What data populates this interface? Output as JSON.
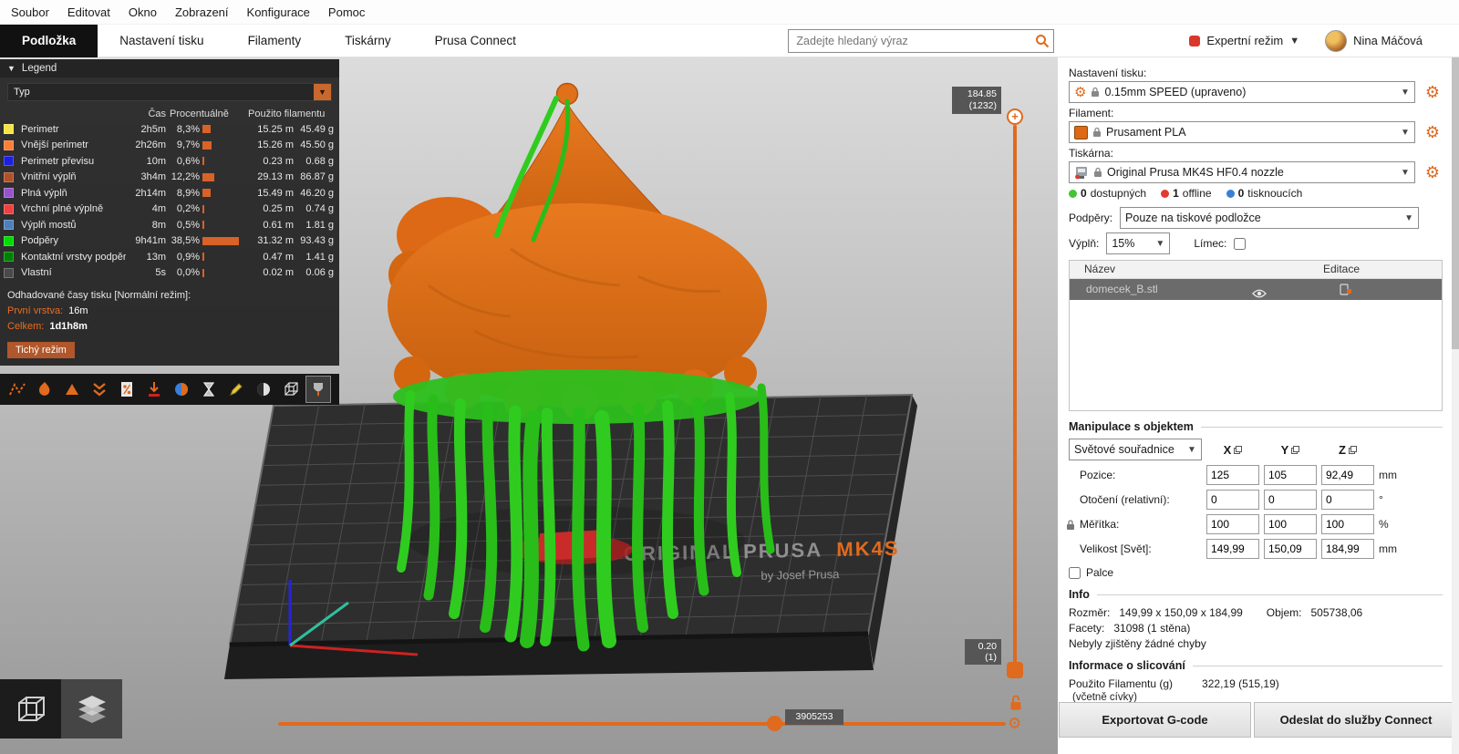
{
  "menubar": {
    "items": [
      "Soubor",
      "Editovat",
      "Okno",
      "Zobrazení",
      "Konfigurace",
      "Pomoc"
    ]
  },
  "tabbar": {
    "tabs": [
      "Podložka",
      "Nastavení tisku",
      "Filamenty",
      "Tiskárny",
      "Prusa Connect"
    ],
    "active_tab": "Podložka",
    "search_placeholder": "Zadejte hledaný výraz",
    "mode_label": "Expertní režim",
    "user_name": "Nina Máčová"
  },
  "legend": {
    "title": "Legend",
    "type_value": "Typ",
    "columns": {
      "time": "Čas",
      "percent": "Procentuálně",
      "used": "Použito filamentu"
    },
    "rows": [
      {
        "label": "Perimetr",
        "color": "#F5E445",
        "time": "2h5m",
        "pct": "8,3%",
        "pct_num": 8.3,
        "len": "15.25 m",
        "weight": "45.49 g"
      },
      {
        "label": "Vnější perimetr",
        "color": "#FF7D38",
        "time": "2h26m",
        "pct": "9,7%",
        "pct_num": 9.7,
        "len": "15.26 m",
        "weight": "45.50 g"
      },
      {
        "label": "Perimetr převisu",
        "color": "#1F1FDE",
        "time": "10m",
        "pct": "0,6%",
        "pct_num": 0.6,
        "len": "0.23 m",
        "weight": "0.68 g"
      },
      {
        "label": "Vnitřní výplň",
        "color": "#B05129",
        "time": "3h4m",
        "pct": "12,2%",
        "pct_num": 12.2,
        "len": "29.13 m",
        "weight": "86.87 g"
      },
      {
        "label": "Plná výplň",
        "color": "#9654CC",
        "time": "2h14m",
        "pct": "8,9%",
        "pct_num": 8.9,
        "len": "15.49 m",
        "weight": "46.20 g"
      },
      {
        "label": "Vrchní plné výplně",
        "color": "#F04040",
        "time": "4m",
        "pct": "0,2%",
        "pct_num": 0.2,
        "len": "0.25 m",
        "weight": "0.74 g"
      },
      {
        "label": "Výplň mostů",
        "color": "#4D80BA",
        "time": "8m",
        "pct": "0,5%",
        "pct_num": 0.5,
        "len": "0.61 m",
        "weight": "1.81 g"
      },
      {
        "label": "Podpěry",
        "color": "#00DC00",
        "time": "9h41m",
        "pct": "38,5%",
        "pct_num": 38.5,
        "len": "31.32 m",
        "weight": "93.43 g"
      },
      {
        "label": "Kontaktní vrstvy podpěr",
        "color": "#008000",
        "time": "13m",
        "pct": "0,9%",
        "pct_num": 0.9,
        "len": "0.47 m",
        "weight": "1.41 g"
      },
      {
        "label": "Vlastní",
        "color": "#4A4A4A",
        "time": "5s",
        "pct": "0,0%",
        "pct_num": 0.0,
        "len": "0.02 m",
        "weight": "0.06 g"
      }
    ],
    "estimated_title": "Odhadované časy tisku [Normální režim]:",
    "first_layer_label": "První vrstva:",
    "first_layer_value": "16m",
    "total_label": "Celkem:",
    "total_value": "1d1h8m",
    "stealth_mode_label": "Tichý režim"
  },
  "viewport": {
    "layer_top_badge": {
      "line1": "184.85",
      "line2": "(1232)"
    },
    "layer_bottom_badge": {
      "line1": "0.20",
      "line2": "(1)"
    },
    "move_badge": "3905253",
    "bed": {
      "brand": "ORIGINAL PRUSA",
      "model": "MK4S",
      "byline": "by Josef Prusa"
    }
  },
  "sidebar": {
    "print_settings": {
      "label": "Nastavení tisku:",
      "value": "0.15mm SPEED (upraveno)"
    },
    "filament": {
      "label": "Filament:",
      "value": "Prusament PLA",
      "color": "#DD6815"
    },
    "printer": {
      "label": "Tiskárna:",
      "value": "Original Prusa MK4S HF0.4 nozzle"
    },
    "printer_status": [
      {
        "count": "0",
        "label": "dostupných",
        "color": "#44C437"
      },
      {
        "count": "1",
        "label": "offline",
        "color": "#E23A30"
      },
      {
        "count": "0",
        "label": "tisknoucích",
        "color": "#3A7FD5"
      }
    ],
    "supports": {
      "label": "Podpěry:",
      "value": "Pouze na tiskové podložce"
    },
    "infill": {
      "label": "Výplň:",
      "value": "15%"
    },
    "brim": {
      "label": "Límec:"
    },
    "object_list": {
      "columns": {
        "name": "Název",
        "edit": "Editace"
      },
      "rows": [
        {
          "name": "domecek_B.stl"
        }
      ]
    },
    "manipulation": {
      "title": "Manipulace s objektem",
      "coords_value": "Světové souřadnice",
      "axis_x": "X",
      "axis_y": "Y",
      "axis_z": "Z",
      "rows": [
        {
          "label": "Pozice:",
          "x": "125",
          "y": "105",
          "z": "92,49",
          "unit": "mm"
        },
        {
          "label": "Otočení (relativní):",
          "x": "0",
          "y": "0",
          "z": "0",
          "unit": "°"
        },
        {
          "label": "Měřítka:",
          "x": "100",
          "y": "100",
          "z": "100",
          "unit": "%"
        },
        {
          "label": "Velikost [Svět]:",
          "x": "149,99",
          "y": "150,09",
          "z": "184,99",
          "unit": "mm"
        }
      ],
      "inches_label": "Palce"
    },
    "info": {
      "title": "Info",
      "size_label": "Rozměr:",
      "size_value": "149,99 x 150,09 x 184,99",
      "volume_label": "Objem:",
      "volume_value": "505738,06",
      "facets_label": "Facety:",
      "facets_value": "31098 (1 stěna)",
      "no_errors": "Nebyly zjištěny žádné chyby"
    },
    "sliced_info": {
      "title": "Informace o slicování",
      "filament_label": "Použito Filamentu (g)",
      "filament_sub": "(včetně cívky)",
      "filament_value": "322,19 (515,19)"
    },
    "buttons": {
      "export": "Exportovat G-code",
      "connect": "Odeslat do služby Connect"
    }
  }
}
